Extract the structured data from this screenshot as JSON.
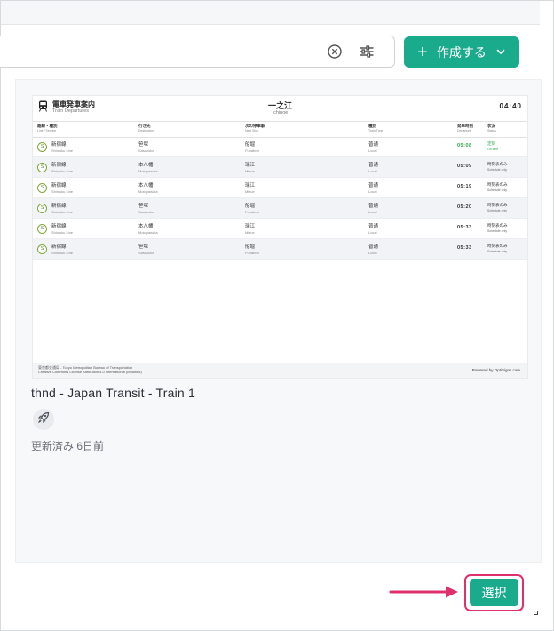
{
  "search": {
    "placeholder": ""
  },
  "toolbar": {
    "create_label": "作成する"
  },
  "card": {
    "title": "thnd - Japan Transit - Train 1",
    "updated": "更新済み 6日前"
  },
  "preview": {
    "header_title": "電車発車案内",
    "header_sub": "Train Departures",
    "station": "一之江",
    "station_en": "Ichinoe",
    "clock": "04:40",
    "columns": [
      {
        "jp": "路線・種別",
        "en": "Line / Service"
      },
      {
        "jp": "行き先",
        "en": "Destination"
      },
      {
        "jp": "次の停車駅",
        "en": "Next Stop"
      },
      {
        "jp": "種別",
        "en": "Train Type"
      },
      {
        "jp": "発車時刻",
        "en": "Departure"
      },
      {
        "jp": "状況",
        "en": "Status"
      }
    ],
    "rows": [
      {
        "badge": "S",
        "line": "新宿線",
        "line_en": "Shinjuku Line",
        "dest": "笹塚",
        "dest_en": "Sasazuka",
        "next": "船堀",
        "next_en": "Funabori",
        "type": "普通",
        "type_en": "Local",
        "dep": "05:08",
        "status": "定刻",
        "status_en": "On time"
      },
      {
        "badge": "S",
        "line": "新宿線",
        "line_en": "Shinjuku Line",
        "dest": "本八幡",
        "dest_en": "Motoyawata",
        "next": "瑞江",
        "next_en": "Mizue",
        "type": "普通",
        "type_en": "Local",
        "dep": "05:09",
        "status": "時刻表のみ",
        "status_en": "Schedule only"
      },
      {
        "badge": "S",
        "line": "新宿線",
        "line_en": "Shinjuku Line",
        "dest": "本八幡",
        "dest_en": "Motoyawata",
        "next": "瑞江",
        "next_en": "Mizue",
        "type": "普通",
        "type_en": "Local",
        "dep": "05:19",
        "status": "時刻表のみ",
        "status_en": "Schedule only"
      },
      {
        "badge": "S",
        "line": "新宿線",
        "line_en": "Shinjuku Line",
        "dest": "笹塚",
        "dest_en": "Sasazuka",
        "next": "船堀",
        "next_en": "Funabori",
        "type": "普通",
        "type_en": "Local",
        "dep": "05:20",
        "status": "時刻表のみ",
        "status_en": "Schedule only"
      },
      {
        "badge": "S",
        "line": "新宿線",
        "line_en": "Shinjuku Line",
        "dest": "本八幡",
        "dest_en": "Motoyawata",
        "next": "瑞江",
        "next_en": "Mizue",
        "type": "普通",
        "type_en": "Local",
        "dep": "05:33",
        "status": "時刻表のみ",
        "status_en": "Schedule only"
      },
      {
        "badge": "S",
        "line": "新宿線",
        "line_en": "Shinjuku Line",
        "dest": "笹塚",
        "dest_en": "Sasazuka",
        "next": "船堀",
        "next_en": "Funabori",
        "type": "普通",
        "type_en": "Local",
        "dep": "05:33",
        "status": "時刻表のみ",
        "status_en": "Schedule only"
      }
    ],
    "footer_left_1": "東京都交通局 - Tokyo Metropolitan Bureau of Transportation",
    "footer_left_2": "Creative Commons License Attribution 4.0 International (Modified)",
    "footer_right": "Powered by OptiSigns.com"
  },
  "footer": {
    "select_label": "選択"
  },
  "colors": {
    "accent": "#1aaa8c",
    "highlight": "#e0306a",
    "on_time": "#2aa847"
  },
  "icons": [
    "clear-icon",
    "filter-sliders-icon",
    "plus-icon",
    "chevron-down-icon",
    "train-icon",
    "rocket-icon",
    "arrow-icon"
  ]
}
